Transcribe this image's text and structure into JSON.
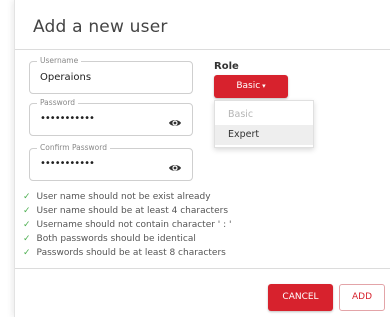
{
  "dialog": {
    "title": "Add a new user"
  },
  "form": {
    "username": {
      "legend": "Username",
      "value": "Operaions"
    },
    "password": {
      "legend": "Password",
      "value": "•••••••••••"
    },
    "confirm_password": {
      "legend": "Confirm Password",
      "value": "•••••••••••"
    },
    "eye_icon": "eye-icon"
  },
  "role": {
    "label": "Role",
    "selected": "Basic",
    "caret": "▾",
    "options": [
      "Basic",
      "Expert"
    ]
  },
  "rules": {
    "check_symbol": "✓",
    "items": [
      "User name should not be exist already",
      "User name should be at least 4 characters",
      "Username should not contain character ' : '",
      "Both passwords should be identical",
      "Passwords should be at least 8 characters"
    ]
  },
  "footer": {
    "cancel_label": "CANCEL",
    "add_label": "ADD"
  },
  "colors": {
    "accent": "#d7222d",
    "check": "#4caf50"
  }
}
